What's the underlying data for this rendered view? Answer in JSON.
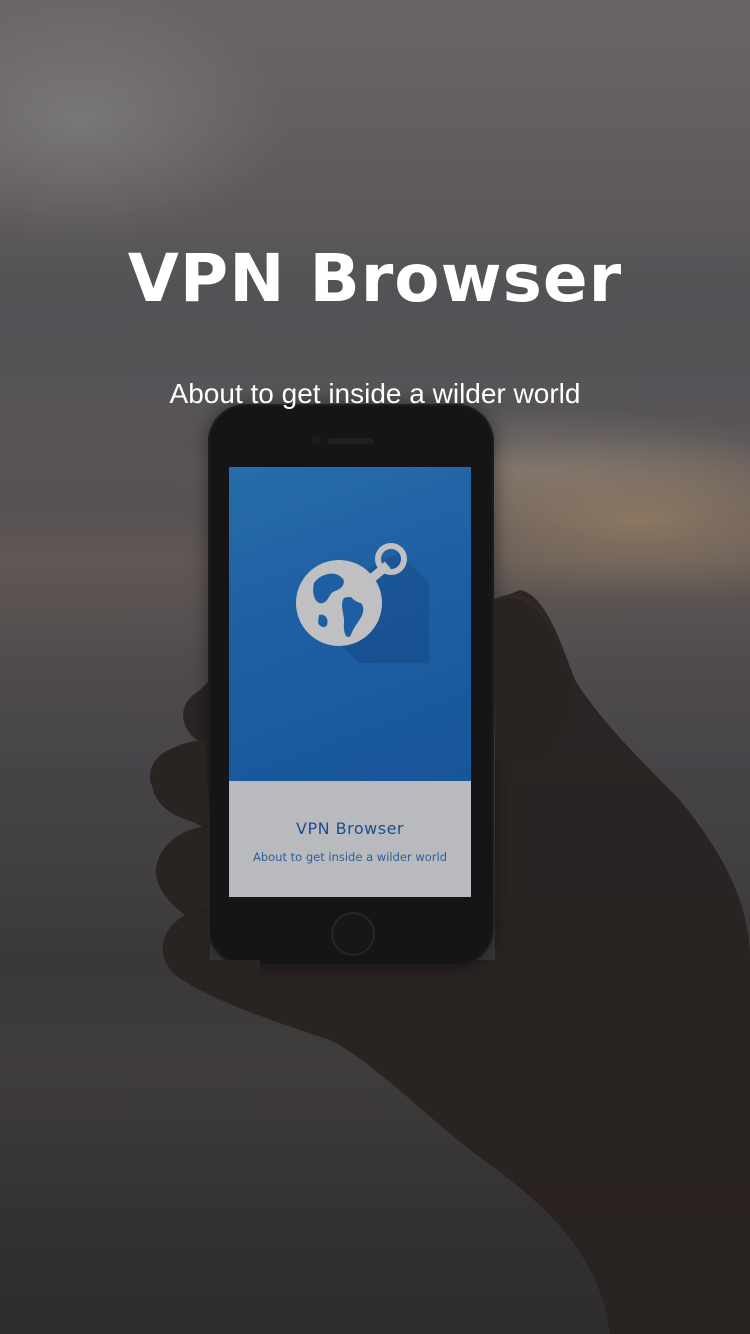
{
  "app": {
    "title": "VPN Browser",
    "tagline": "About to get inside a wilder world"
  },
  "phone_screen": {
    "title": "VPN Browser",
    "subtitle": "About to get inside a wilder world",
    "logo_icon": "globe-anchor-icon"
  },
  "colors": {
    "screen_blue": "#1f79d4",
    "screen_text_blue": "#1a63c0",
    "headline_white": "#ffffff"
  }
}
